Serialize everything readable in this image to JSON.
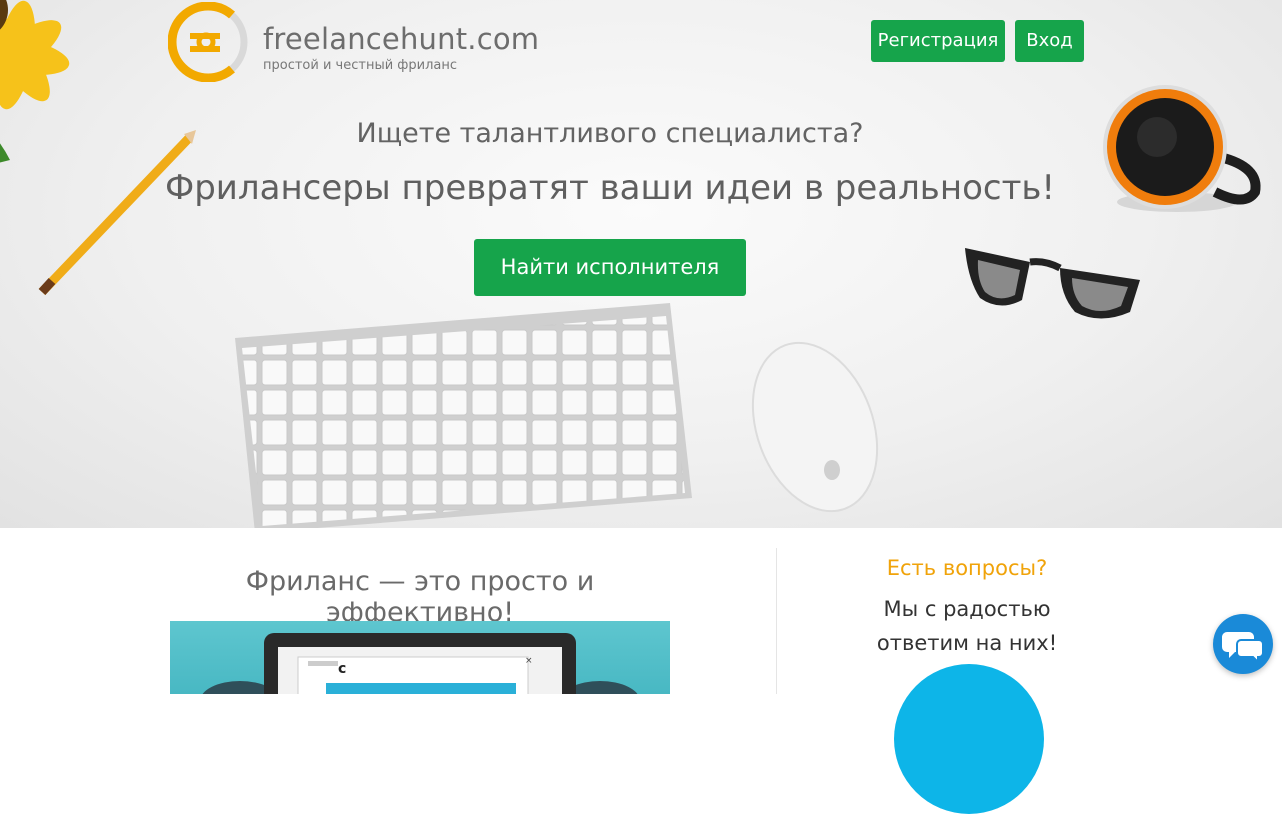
{
  "header": {
    "logo_text": "freelancehunt.com",
    "logo_subtitle": "простой и честный фриланс",
    "register_label": "Регистрация",
    "login_label": "Вход"
  },
  "hero": {
    "question": "Ищете талантливого специалиста?",
    "headline": "Фрилансеры превратят ваши идеи в реальность!",
    "cta_label": "Найти исполнителя"
  },
  "main": {
    "section_title": "Фриланс — это просто и эффективно!"
  },
  "sidebar": {
    "questions_title": "Есть вопросы?",
    "questions_line1": "Мы с радостью",
    "questions_line2": "ответим на них!"
  },
  "colors": {
    "accent_green": "#16a44b",
    "logo_orange": "#f2a900",
    "questions_orange": "#f0a30a",
    "chat_blue": "#1a8ad8"
  },
  "icons": [
    "freelancehunt-logo-icon",
    "chat-bubbles-icon"
  ]
}
